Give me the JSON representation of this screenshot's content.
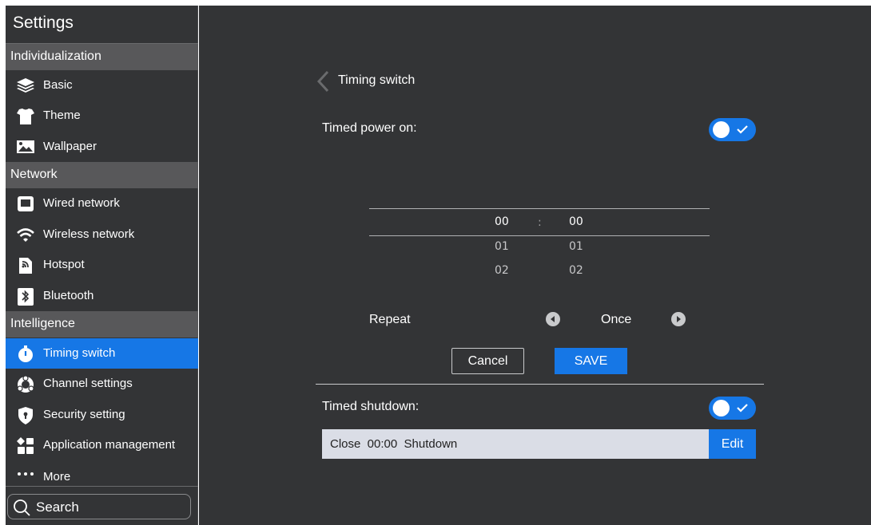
{
  "app": {
    "title": "Settings"
  },
  "sidebar": {
    "sections": [
      {
        "label": "Individualization"
      },
      {
        "label": "Network"
      },
      {
        "label": "Intelligence"
      }
    ],
    "items": [
      {
        "label": "Basic",
        "icon": "layers-icon"
      },
      {
        "label": "Theme",
        "icon": "tshirt-icon"
      },
      {
        "label": "Wallpaper",
        "icon": "image-icon"
      },
      {
        "label": "Wired network",
        "icon": "monitor-icon"
      },
      {
        "label": "Wireless network",
        "icon": "wifi-icon"
      },
      {
        "label": "Hotspot",
        "icon": "hotspot-icon"
      },
      {
        "label": "Bluetooth",
        "icon": "bluetooth-icon"
      },
      {
        "label": "Timing switch",
        "icon": "stopwatch-icon",
        "active": true
      },
      {
        "label": "Channel settings",
        "icon": "channel-icon"
      },
      {
        "label": "Security setting",
        "icon": "shield-icon"
      },
      {
        "label": "Application management",
        "icon": "apps-grid-icon"
      },
      {
        "label": "More",
        "icon": "more-dots-icon"
      }
    ],
    "search": {
      "label": "Search"
    }
  },
  "main": {
    "title": "Timing switch",
    "power_on": {
      "label": "Timed power on:",
      "enabled": true
    },
    "picker": {
      "separator": ":",
      "hours": [
        "00",
        "01",
        "02"
      ],
      "minutes": [
        "00",
        "01",
        "02"
      ]
    },
    "repeat": {
      "label": "Repeat",
      "value": "Once"
    },
    "buttons": {
      "cancel": "Cancel",
      "save": "SAVE"
    },
    "shutdown": {
      "label": "Timed shutdown:",
      "enabled": true
    },
    "schedule": {
      "text": "Close  00:00  Shutdown",
      "edit": "Edit"
    }
  },
  "colors": {
    "accent": "#1677e6",
    "background": "#333436",
    "section": "#58585a"
  }
}
